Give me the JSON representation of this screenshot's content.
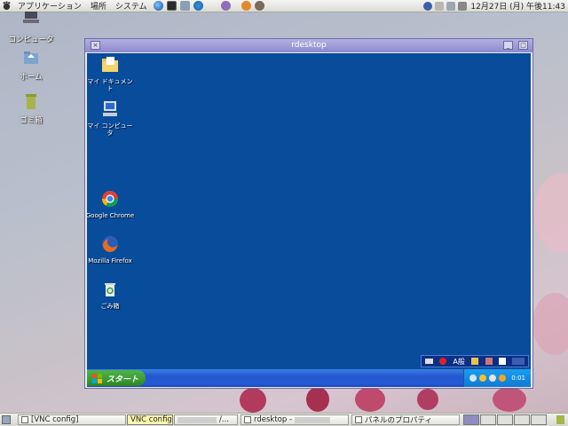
{
  "top_panel": {
    "menu_applications": "アプリケーション",
    "menu_places": "場所",
    "menu_system": "システム",
    "clock": "12月27日 (月) 午後11:43"
  },
  "host_desktop": {
    "icons": [
      {
        "label": "コンピュータ"
      },
      {
        "label": "ホーム"
      },
      {
        "label": "ゴミ箱"
      }
    ]
  },
  "rdesktop_window": {
    "title": "rdesktop",
    "close_symbol": "×",
    "minimize_symbol": "_",
    "maximize_symbol": "□"
  },
  "remote_desktop": {
    "icons": [
      {
        "label": "マイ ドキュメント"
      },
      {
        "label": "マイ コンピュータ"
      },
      {
        "label": "Google Chrome"
      },
      {
        "label": "Mozilla Firefox"
      },
      {
        "label": "ごみ箱"
      }
    ],
    "langbar_text": "A般",
    "start_label": "スタート",
    "tray_time": "0:01"
  },
  "bottom_panel": {
    "tasks": [
      {
        "label": "[VNC config]"
      },
      {
        "label": "VNC config"
      },
      {
        "label": "/..."
      },
      {
        "label": "rdesktop -"
      },
      {
        "label": "パネルのプロパティ"
      }
    ]
  }
}
